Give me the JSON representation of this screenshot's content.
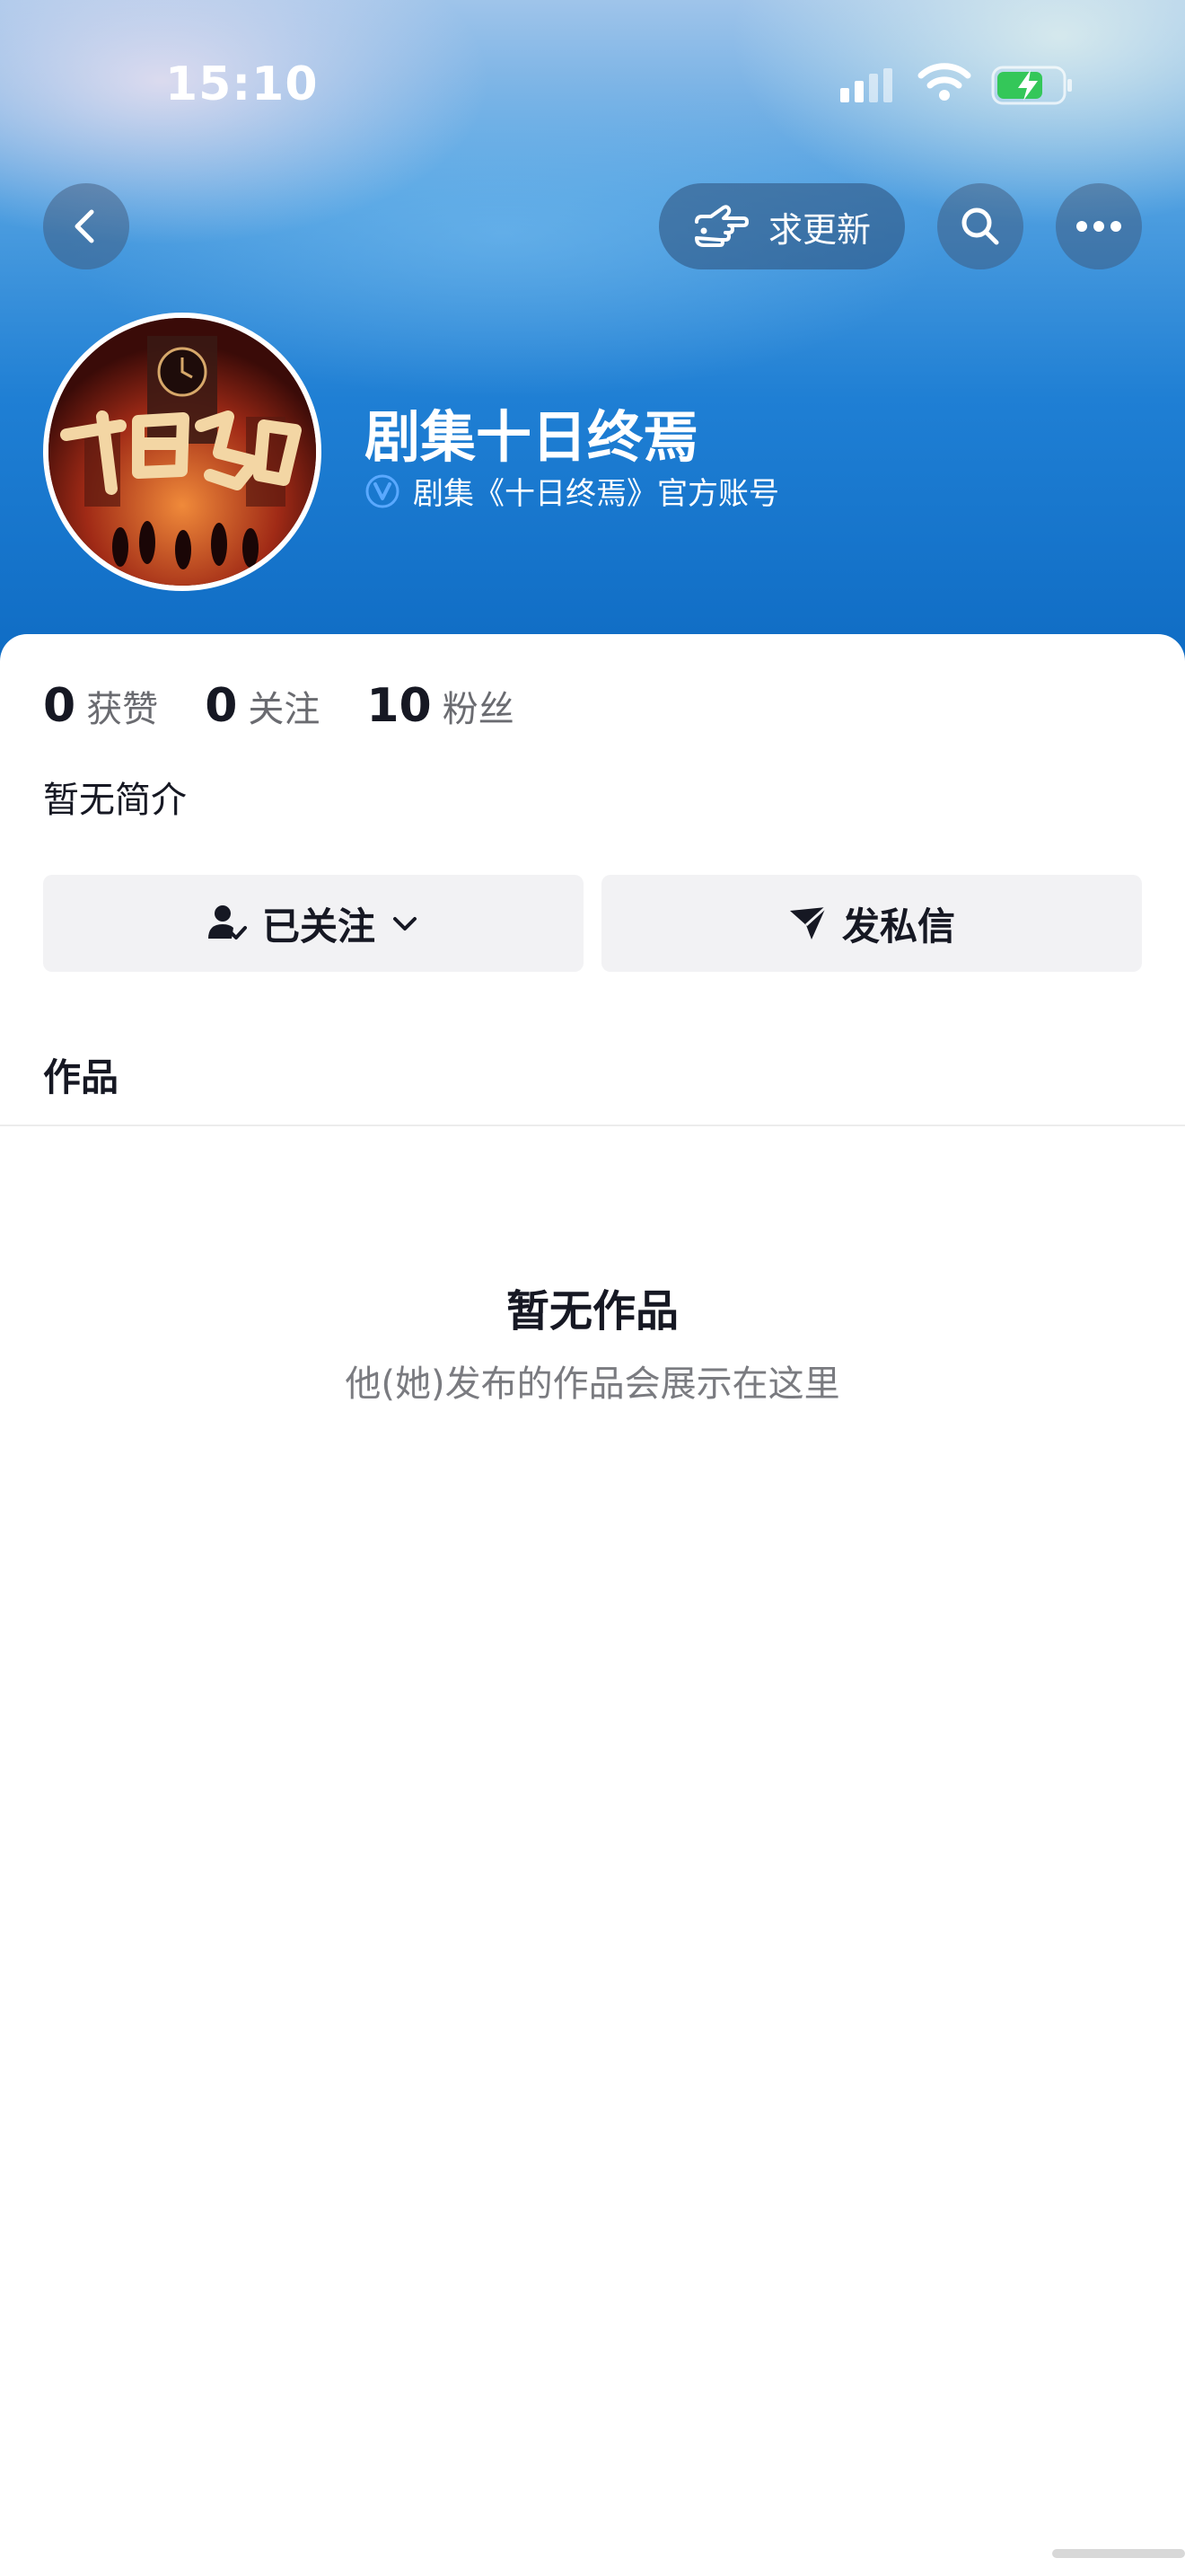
{
  "status_bar": {
    "time": "15:10"
  },
  "top_bar": {
    "back_icon": "chevron-left-icon",
    "request_update_label": "求更新",
    "request_update_icon": "pointing-hand-icon",
    "search_icon": "search-icon",
    "more_icon": "more-dots-icon"
  },
  "profile": {
    "name": "剧集十日终焉",
    "verified_text": "剧集《十日终焉》官方账号",
    "avatar_title": "十日终焉"
  },
  "stats": [
    {
      "value": "0",
      "label": "获赞"
    },
    {
      "value": "0",
      "label": "关注"
    },
    {
      "value": "10",
      "label": "粉丝"
    }
  ],
  "bio": "暂无简介",
  "actions": {
    "follow_label": "已关注",
    "message_label": "发私信"
  },
  "tabs": {
    "works_label": "作品"
  },
  "empty_state": {
    "title": "暂无作品",
    "subtitle": "他(她)发布的作品会展示在这里"
  },
  "colors": {
    "header_blue": "#1f7fd4",
    "battery_green": "#34c759",
    "verified_blue": "#5aa9ff",
    "button_bg": "#f2f2f4"
  }
}
